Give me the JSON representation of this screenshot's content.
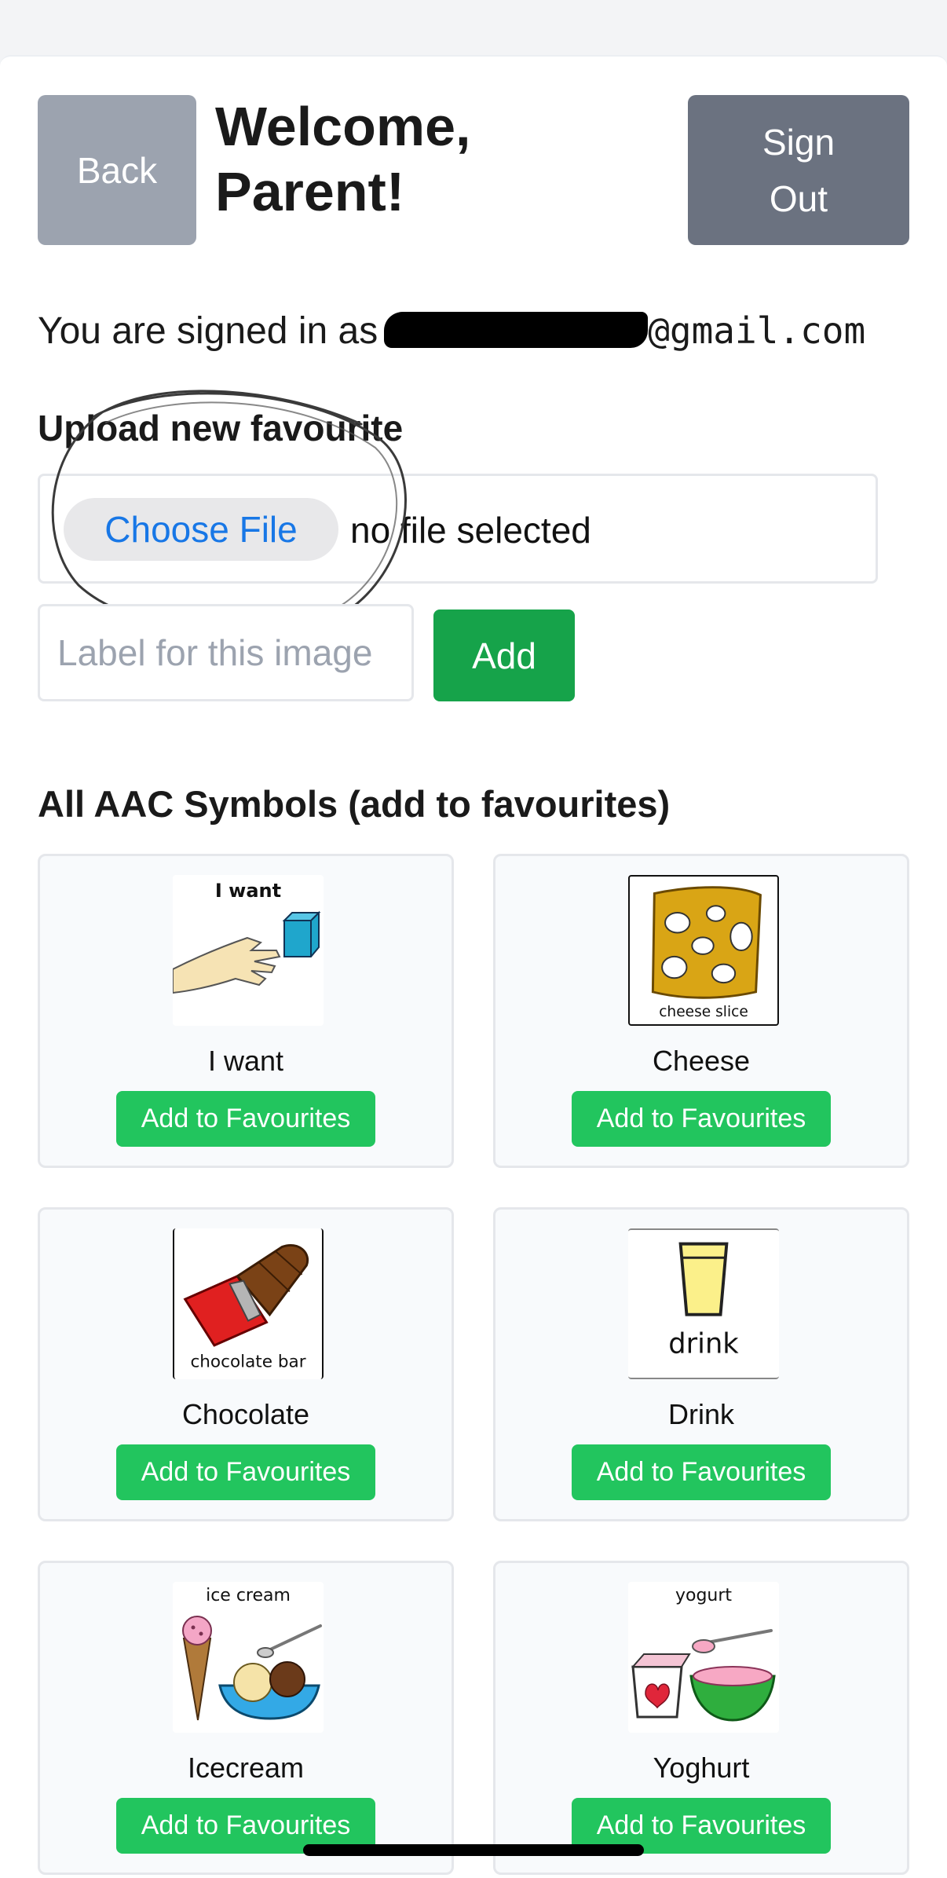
{
  "header": {
    "back_label": "Back",
    "welcome": "Welcome, Parent!",
    "signout_label": "Sign\nOut"
  },
  "account": {
    "signed_in_prefix": "You are signed in as",
    "email_domain": "@gmail.com"
  },
  "upload": {
    "title": "Upload new favourite",
    "choose_file_label": "Choose File",
    "file_status": "no file selected",
    "label_placeholder": "Label for this image",
    "add_label": "Add"
  },
  "symbols": {
    "title": "All AAC Symbols (add to favourites)",
    "button_label": "Add to Favourites",
    "items": [
      {
        "label": "I want",
        "caption": "I want",
        "icon": "i-want-icon"
      },
      {
        "label": "Cheese",
        "caption": "cheese slice",
        "icon": "cheese-icon"
      },
      {
        "label": "Chocolate",
        "caption": "chocolate bar",
        "icon": "chocolate-icon"
      },
      {
        "label": "Drink",
        "caption": "drink",
        "icon": "drink-icon"
      },
      {
        "label": "Icecream",
        "caption": "ice cream",
        "icon": "icecream-icon"
      },
      {
        "label": "Yoghurt",
        "caption": "yogurt",
        "icon": "yogurt-icon"
      }
    ]
  },
  "colors": {
    "back_button": "#9ca3af",
    "signout_button": "#6b7280",
    "add_button": "#16a34a",
    "favourite_button": "#22c55e",
    "link_blue": "#1877e6"
  }
}
